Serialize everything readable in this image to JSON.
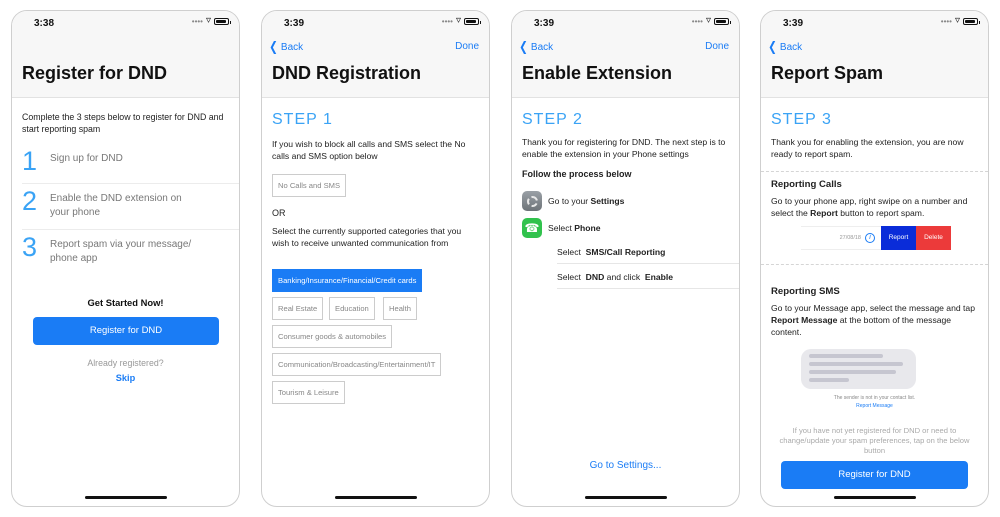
{
  "status": {
    "battery_level": 0.9
  },
  "screen1": {
    "time": "3:38",
    "title": "Register for DND",
    "intro": "Complete the 3 steps below to register for DND and start reporting spam",
    "steps": [
      {
        "num": "1",
        "text": "Sign up for DND"
      },
      {
        "num": "2",
        "text": "Enable the DND extension on your phone"
      },
      {
        "num": "3",
        "text": "Report spam via your message/ phone app"
      }
    ],
    "cta_heading": "Get Started Now!",
    "register_button": "Register for DND",
    "already_text": "Already registered?",
    "skip_link": "Skip"
  },
  "screen2": {
    "time": "3:39",
    "back": "Back",
    "done": "Done",
    "title": "DND Registration",
    "step": "STEP 1",
    "block_text": "If you wish to block all calls and SMS select the No calls and SMS option below",
    "no_calls_option": "No Calls and SMS",
    "or_text": "OR",
    "select_text": "Select the currently supported categories that you wish to receive unwanted communication from",
    "categories": [
      "Banking/Insurance/Financial/Credit cards",
      "Real Estate",
      "Education",
      "Health",
      "Consumer goods & automobiles",
      "Communication/Broadcasting/Entertainment/IT",
      "Tourism & Leisure"
    ],
    "selected_category": "Banking/Insurance/Financial/Credit cards"
  },
  "screen3": {
    "time": "3:39",
    "back": "Back",
    "done": "Done",
    "title": "Enable Extension",
    "step": "STEP 2",
    "thanks": "Thank you for registering for DND. The next step is to enable the extension in your Phone settings",
    "follow": "Follow the process below",
    "settings_prefix": "Go to your ",
    "settings_bold": "Settings",
    "phone_prefix": "Select ",
    "phone_bold": "Phone",
    "sub1_prefix": "Select ",
    "sub1_bold": "SMS/Call Reporting",
    "sub2_prefix": "Select ",
    "sub2_bold1": "DND",
    "sub2_mid": " and click ",
    "sub2_bold2": "Enable",
    "go_settings": "Go to Settings..."
  },
  "screen4": {
    "time": "3:39",
    "back": "Back",
    "title": "Report Spam",
    "step": "STEP 3",
    "thanks": "Thank you for enabling the extension, you are now ready to report spam.",
    "calls_heading": "Reporting Calls",
    "calls_text_1": "Go to your phone app, right swipe on a  number and select the ",
    "calls_text_bold": "Report",
    "calls_text_2": " button to report spam.",
    "swipe_date": "27/08/18",
    "swipe_report": "Report",
    "swipe_delete": "Delete",
    "sms_heading": "Reporting SMS",
    "sms_text_1": "Go to  your Message app,  select the message and tap ",
    "sms_text_bold": "Report Message",
    "sms_text_2": "  at the bottom of the message content.",
    "sender_note": "The sender is not in your contact list.",
    "report_message_link": "Report Message",
    "not_registered": "If you have not yet registered for DND or need to change/update your spam preferences, tap on the below button",
    "register_button": "Register for DND"
  }
}
